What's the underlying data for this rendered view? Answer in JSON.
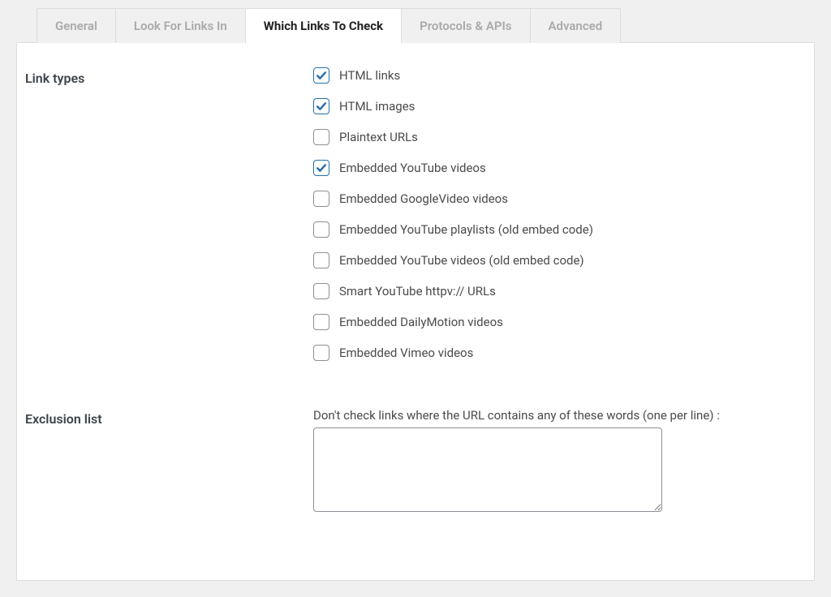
{
  "tabs": [
    {
      "label": "General",
      "active": false
    },
    {
      "label": "Look For Links In",
      "active": false
    },
    {
      "label": "Which Links To Check",
      "active": true
    },
    {
      "label": "Protocols & APIs",
      "active": false
    },
    {
      "label": "Advanced",
      "active": false
    }
  ],
  "section_link_types": {
    "heading": "Link types",
    "options": [
      {
        "label": "HTML links",
        "checked": true
      },
      {
        "label": "HTML images",
        "checked": true
      },
      {
        "label": "Plaintext URLs",
        "checked": false
      },
      {
        "label": "Embedded YouTube videos",
        "checked": true
      },
      {
        "label": "Embedded GoogleVideo videos",
        "checked": false
      },
      {
        "label": "Embedded YouTube playlists (old embed code)",
        "checked": false
      },
      {
        "label": "Embedded YouTube videos (old embed code)",
        "checked": false
      },
      {
        "label": "Smart YouTube httpv:// URLs",
        "checked": false
      },
      {
        "label": "Embedded DailyMotion videos",
        "checked": false
      },
      {
        "label": "Embedded Vimeo videos",
        "checked": false
      }
    ]
  },
  "section_exclusion": {
    "heading": "Exclusion list",
    "description": "Don't check links where the URL contains any of these words (one per line) :",
    "value": ""
  }
}
